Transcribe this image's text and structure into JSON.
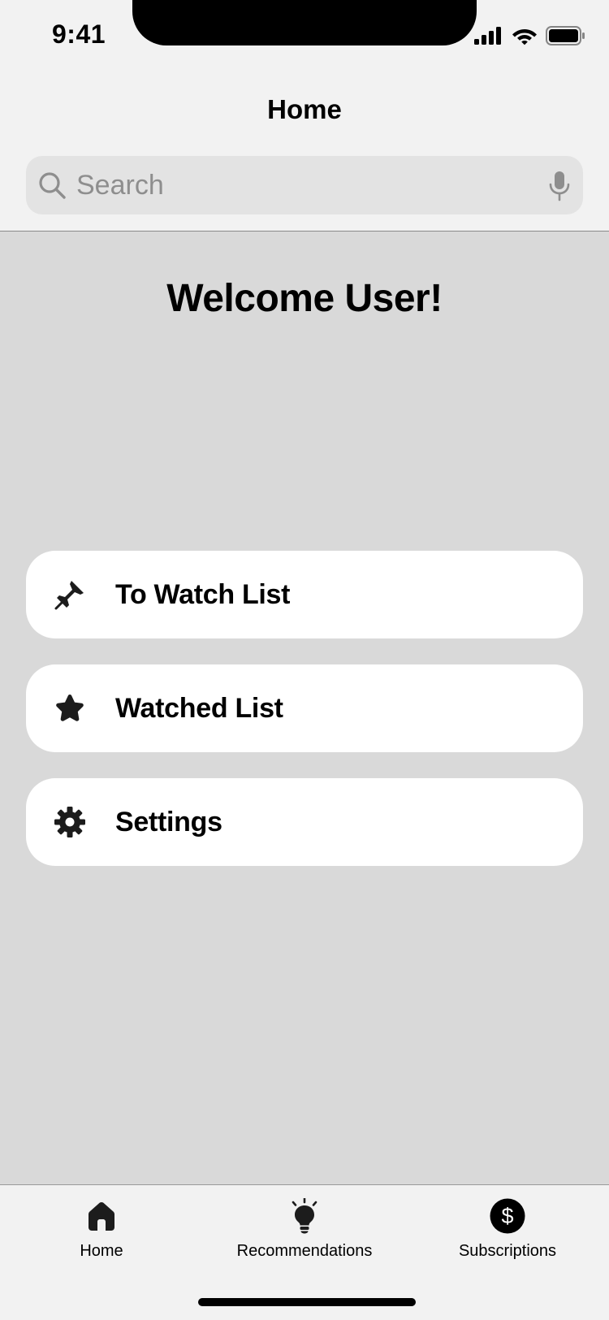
{
  "status_bar": {
    "time": "9:41",
    "icons": [
      "cellular-signal-icon",
      "wifi-icon",
      "battery-icon"
    ]
  },
  "header": {
    "title": "Home",
    "search": {
      "placeholder": "Search",
      "value": "",
      "icon": "search-icon",
      "mic_icon": "microphone-icon"
    }
  },
  "main": {
    "welcome": "Welcome User!",
    "menu": [
      {
        "label": "To Watch List",
        "icon": "pin-icon"
      },
      {
        "label": "Watched List",
        "icon": "star-icon"
      },
      {
        "label": "Settings",
        "icon": "gear-icon"
      }
    ]
  },
  "tab_bar": {
    "tabs": [
      {
        "label": "Home",
        "icon": "home-icon"
      },
      {
        "label": "Recommendations",
        "icon": "lightbulb-icon"
      },
      {
        "label": "Subscriptions",
        "icon": "dollar-icon"
      }
    ]
  },
  "colors": {
    "header_bg": "#f2f2f2",
    "content_bg": "#d9d9d9",
    "card_bg": "#ffffff",
    "search_bg": "#e3e3e3",
    "text": "#000000",
    "muted": "#8e8e8e"
  }
}
